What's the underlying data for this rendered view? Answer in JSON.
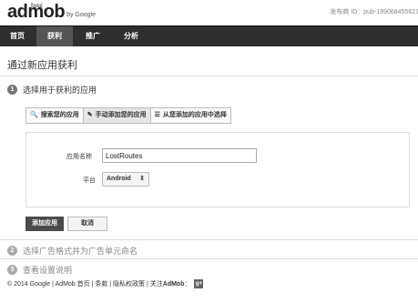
{
  "header": {
    "logo_text": "admob",
    "logo_beta": "[beta]",
    "logo_by": "by Google",
    "publisher_id": "发布商 ID：pub-199068455621"
  },
  "nav": {
    "items": [
      {
        "label": "首页",
        "active": false
      },
      {
        "label": "获利",
        "active": true
      },
      {
        "label": "推广",
        "active": false
      },
      {
        "label": "分析",
        "active": false
      }
    ]
  },
  "page": {
    "title": "通过新应用获利"
  },
  "steps": [
    {
      "number": "1",
      "label": "选择用于获利的应用"
    },
    {
      "number": "2",
      "label": "选择广告格式并为广告单元命名"
    },
    {
      "number": "3",
      "label": "查看设置说明"
    }
  ],
  "tabs": [
    {
      "label": "搜索您的应用",
      "icon": "search-icon",
      "icon_glyph": "🔍"
    },
    {
      "label": "手动添加您的应用",
      "icon": "pencil-icon",
      "icon_glyph": "✎"
    },
    {
      "label": "从您添加的应用中选择",
      "icon": "list-icon",
      "icon_glyph": "☰"
    }
  ],
  "form": {
    "app_name_label": "应用名称",
    "app_name_value": "LostRoutes",
    "platform_label": "平台",
    "platform_value": "Android",
    "platform_arrow": "⇕"
  },
  "buttons": {
    "add_app": "添加应用",
    "cancel": "取消"
  },
  "footer": {
    "copyright": "© 2014 Google | AdMob 首页 | 条款 | 隐私权政策 | 关注 ",
    "brand": "AdMob",
    "colon": "：",
    "gplus": "g+"
  }
}
